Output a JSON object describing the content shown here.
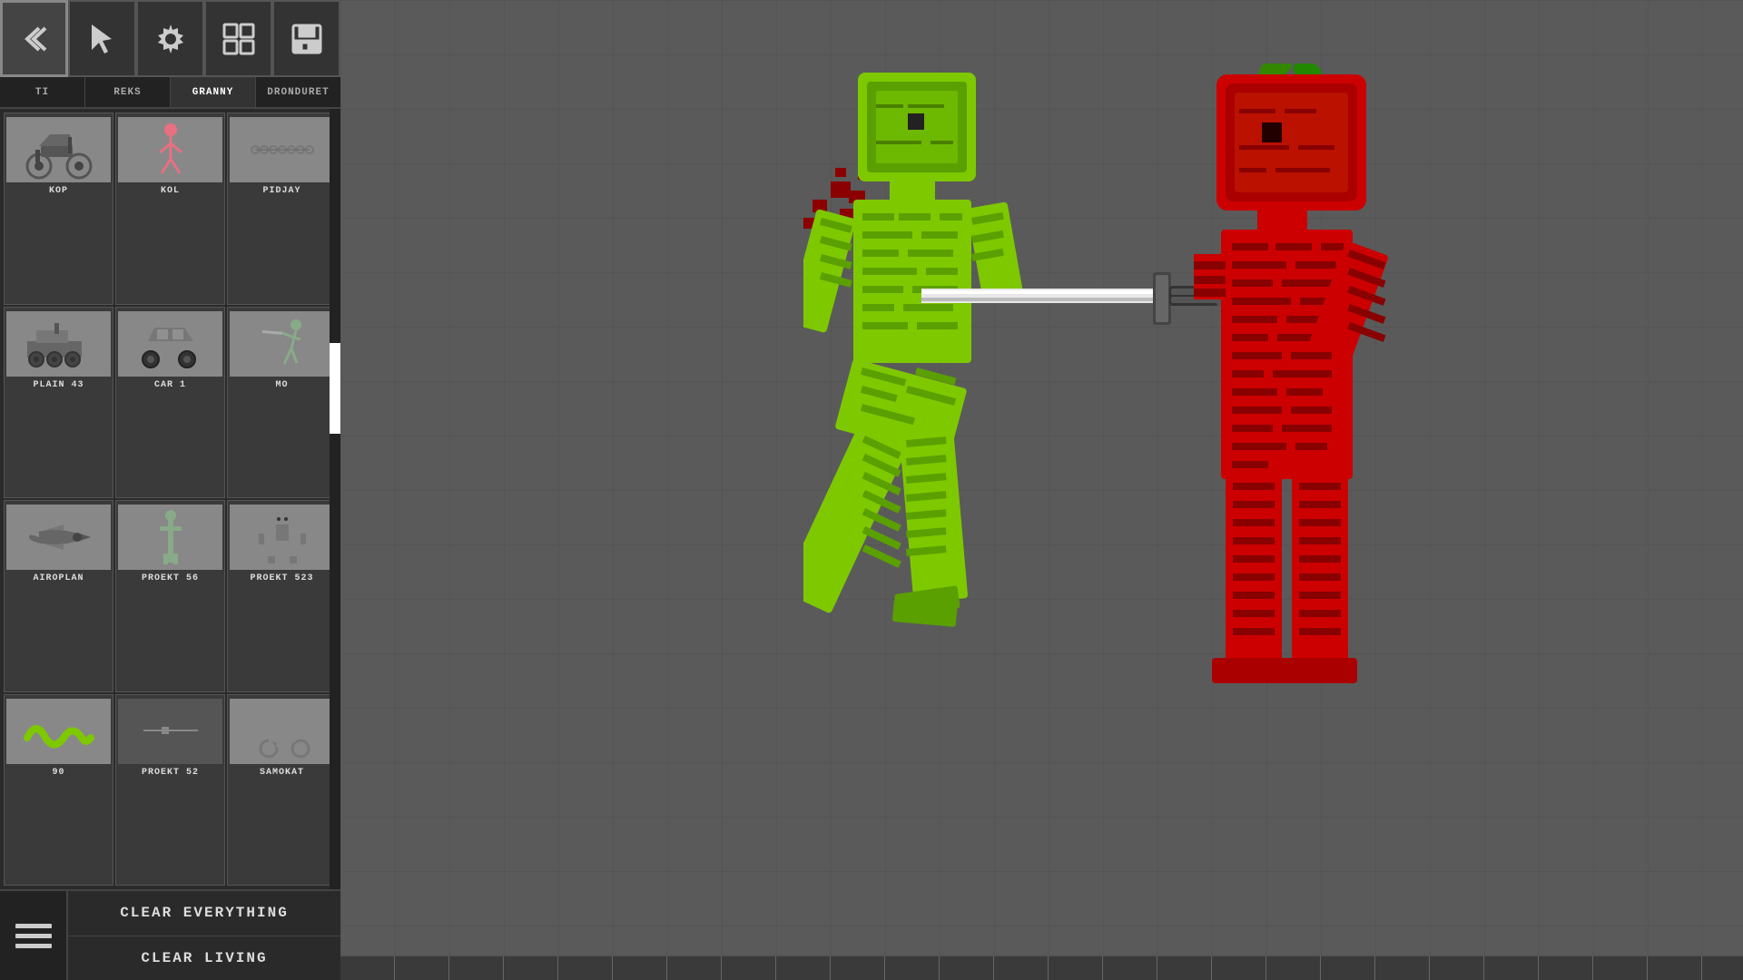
{
  "toolbar": {
    "buttons": [
      {
        "id": "back",
        "label": "←",
        "icon": "back-icon"
      },
      {
        "id": "cursor",
        "label": "↖",
        "icon": "cursor-icon"
      },
      {
        "id": "settings",
        "label": "⚙",
        "icon": "settings-icon"
      },
      {
        "id": "panels",
        "label": "▦",
        "icon": "panels-icon"
      },
      {
        "id": "save",
        "label": "💾",
        "icon": "save-icon"
      }
    ]
  },
  "tabs": [
    {
      "id": "ti",
      "label": "TI",
      "active": false
    },
    {
      "id": "reks",
      "label": "REKS",
      "active": false
    },
    {
      "id": "granny",
      "label": "GRANNY",
      "active": true
    },
    {
      "id": "dronduret",
      "label": "DRONDURET",
      "active": false
    }
  ],
  "grid_items": [
    {
      "id": "kop",
      "label": "KOP",
      "thumb_type": "motorcycle"
    },
    {
      "id": "kol",
      "label": "KOL",
      "thumb_type": "stickfigure"
    },
    {
      "id": "pidjay",
      "label": "PIDJAY",
      "thumb_type": "chain"
    },
    {
      "id": "plain43",
      "label": "PLAIN 43",
      "thumb_type": "plain"
    },
    {
      "id": "car1",
      "label": "CAR 1",
      "thumb_type": "car"
    },
    {
      "id": "mo",
      "label": "MO",
      "thumb_type": "mo"
    },
    {
      "id": "airoplan",
      "label": "AIROPLAN",
      "thumb_type": "plane"
    },
    {
      "id": "proekt56",
      "label": "PROEKT\n56",
      "thumb_type": "proekt56"
    },
    {
      "id": "proekt523",
      "label": "PROEKT\n523",
      "thumb_type": "robot"
    },
    {
      "id": "90",
      "label": "90",
      "thumb_type": "worm"
    },
    {
      "id": "proekt52",
      "label": "PROEKT\n52",
      "thumb_type": "generic_dark"
    },
    {
      "id": "samokat",
      "label": "SAMOKAT",
      "thumb_type": "samokat"
    }
  ],
  "bottom_buttons": {
    "clear_everything": "CLEAR EVERYTHING",
    "clear_living": "CLEAR LIVING"
  },
  "colors": {
    "green_char": "#7ec800",
    "green_char_dark": "#4a8000",
    "red_char": "#cc0000",
    "red_char_dark": "#880000",
    "blood": "#8b0000",
    "sword_blade": "#e8e8e8",
    "sword_handle": "#222",
    "apple_green": "#44aa00"
  }
}
